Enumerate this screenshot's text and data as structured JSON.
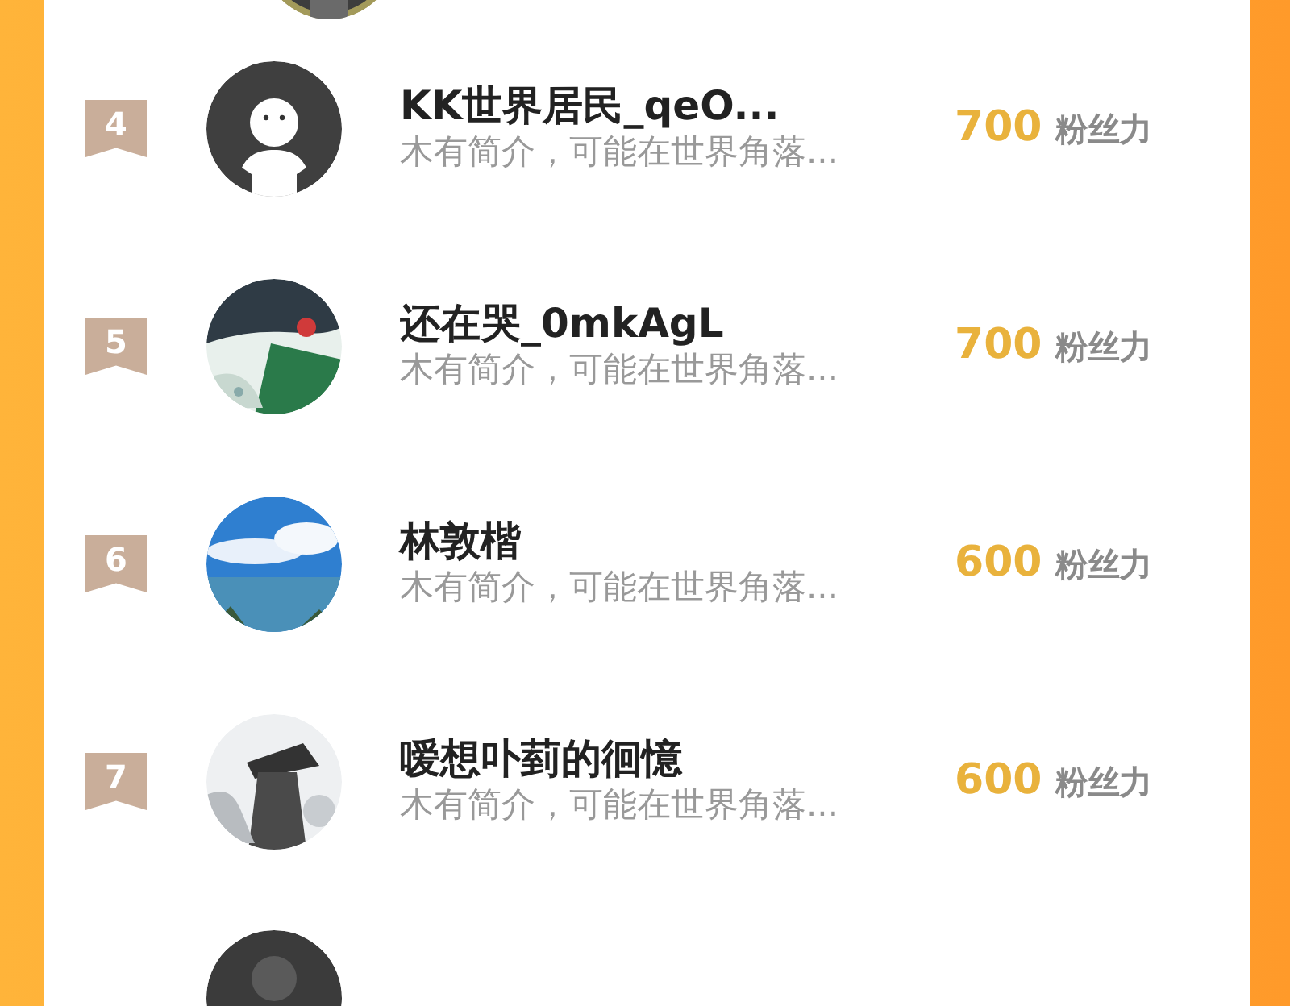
{
  "ranking": [
    {
      "rank": "4",
      "avatar": {
        "kind": "default"
      },
      "name": "KK世界居民_qeO...",
      "bio": "木有简介，可能在世界角落...",
      "fans": "700",
      "fans_label": "粉丝力"
    },
    {
      "rank": "5",
      "name": "还在哭_0mkAgL",
      "bio": "木有简介，可能在世界角落...",
      "fans": "700",
      "fans_label": "粉丝力"
    },
    {
      "rank": "6",
      "name": "林敦楷",
      "bio": "木有简介，可能在世界角落...",
      "fans": "600",
      "fans_label": "粉丝力"
    },
    {
      "rank": "7",
      "name": "嗳想卟菿的徊憶",
      "bio": "木有简介，可能在世界角落...",
      "fans": "600",
      "fans_label": "粉丝力"
    }
  ]
}
